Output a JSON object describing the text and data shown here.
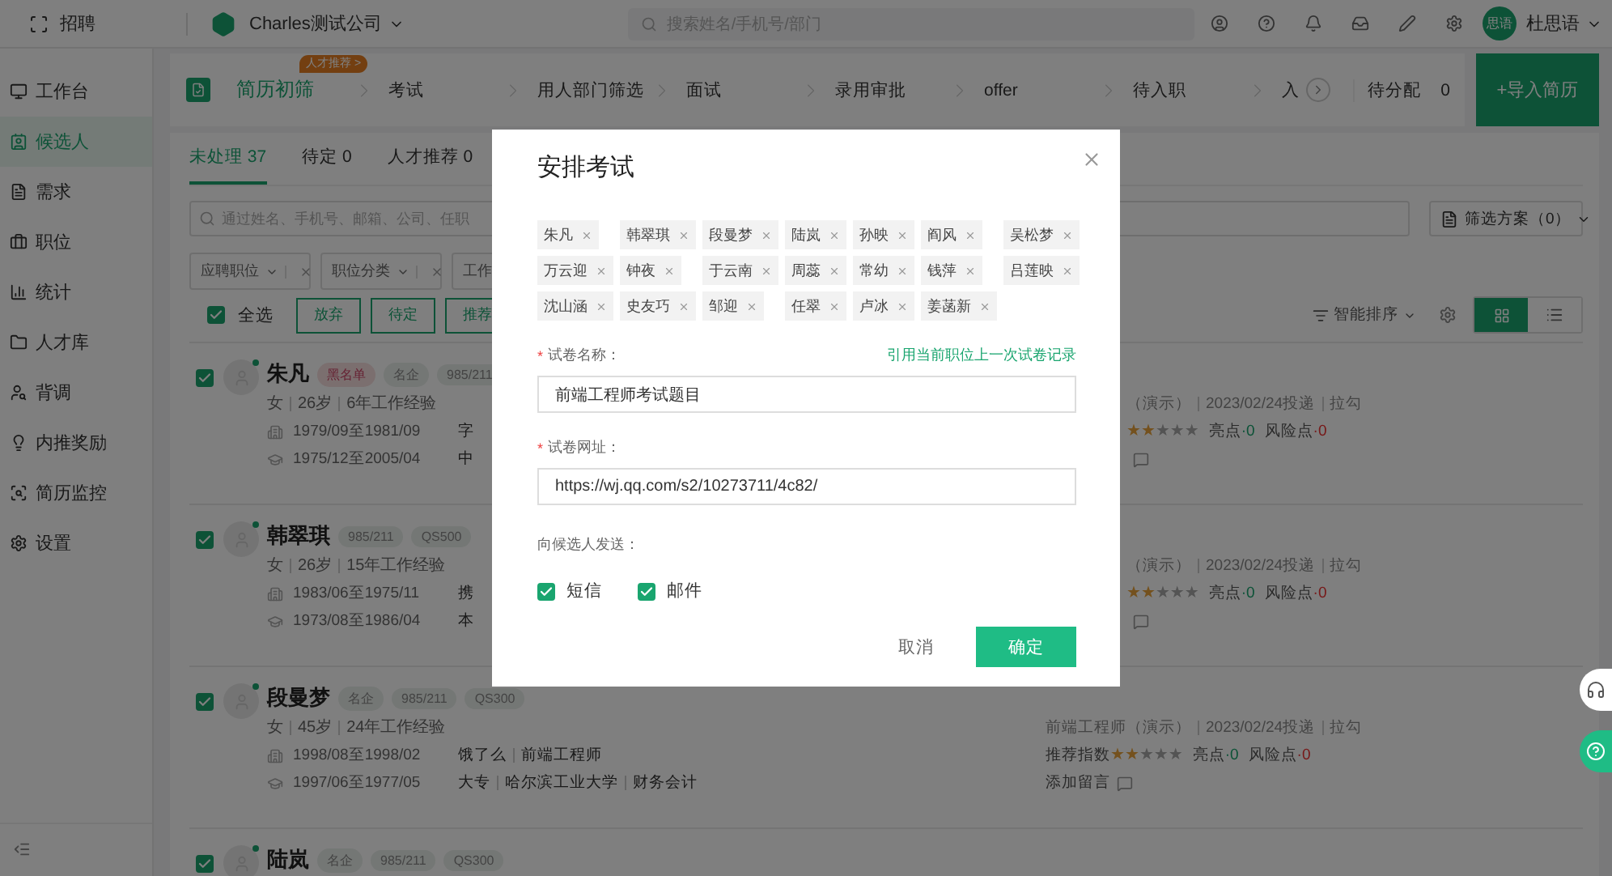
{
  "top_bar": {
    "app_name": "招聘",
    "company": "Charles测试公司",
    "search": {
      "placeholder": "搜索姓名/手机号/部门"
    },
    "user": {
      "avatar": "思语",
      "name": "杜思语"
    }
  },
  "sidebar": {
    "items": [
      {
        "label": "工作台",
        "selected": false
      },
      {
        "label": "候选人",
        "selected": true
      },
      {
        "label": "需求",
        "selected": false
      },
      {
        "label": "职位",
        "selected": false
      },
      {
        "label": "统计",
        "selected": false
      },
      {
        "label": "人才库",
        "selected": false
      },
      {
        "label": "背调",
        "selected": false
      },
      {
        "label": "内推奖励",
        "selected": false
      },
      {
        "label": "简历监控",
        "selected": false
      },
      {
        "label": "设置",
        "selected": false
      }
    ]
  },
  "pipeline": {
    "stages": [
      {
        "label": "简历初筛",
        "selected": true,
        "badge": "人才推荐 >"
      },
      {
        "label": "考试",
        "selected": false
      },
      {
        "label": "用人部门筛选",
        "selected": false
      },
      {
        "label": "面试",
        "selected": false
      },
      {
        "label": "录用审批",
        "selected": false
      },
      {
        "label": "offer",
        "selected": false
      },
      {
        "label": "待入职",
        "selected": false
      },
      {
        "label": "入",
        "selected": false
      }
    ],
    "unassigned": {
      "label": "待分配",
      "count": "0"
    },
    "import_button": "+导入简历"
  },
  "tabs": [
    {
      "label": "未处理",
      "count": "37",
      "selected": true
    },
    {
      "label": "待定",
      "count": "0",
      "selected": false
    },
    {
      "label": "人才推荐",
      "count": "0",
      "selected": false
    }
  ],
  "search": {
    "placeholder": "通过姓名、手机号、邮箱、公司、任职"
  },
  "filter_scheme": "筛选方案（0）",
  "filters": [
    {
      "label": "应聘职位"
    },
    {
      "label": "职位分类"
    },
    {
      "label": "工作"
    }
  ],
  "select_all": {
    "label": "全选",
    "checked": true
  },
  "batch_buttons": [
    "放弃",
    "待定",
    "推荐"
  ],
  "sort": "智能排序",
  "view_modes": [
    {
      "kind": "grid",
      "selected": true
    },
    {
      "kind": "list",
      "selected": false
    }
  ],
  "candidates": [
    {
      "name": "朱凡",
      "checked": true,
      "tags": [
        {
          "label": "黑名单",
          "kind": "blacklist"
        },
        {
          "label": "名企",
          "kind": "plain"
        },
        {
          "label": "985/211",
          "kind": "plain"
        }
      ],
      "profile": [
        "女",
        "26岁",
        "6年工作经验"
      ],
      "work": {
        "period": "1979/09至1981/09",
        "detail": [
          "字"
        ]
      },
      "education": {
        "period": "1975/12至2005/04",
        "detail": [
          "中"
        ]
      },
      "job": "（演示）",
      "applied": "2023/02/24投递",
      "source": "拉勾",
      "stars": 2,
      "highlights": {
        "label": "亮点",
        "count": "·0"
      },
      "risks": {
        "label": "风险点",
        "count": "·0"
      }
    },
    {
      "name": "韩翠琪",
      "checked": true,
      "tags": [
        {
          "label": "985/211",
          "kind": "plain"
        },
        {
          "label": "QS500",
          "kind": "plain"
        }
      ],
      "profile": [
        "女",
        "26岁",
        "15年工作经验"
      ],
      "work": {
        "period": "1983/06至1975/11",
        "detail": [
          "携"
        ]
      },
      "education": {
        "period": "1973/08至1986/04",
        "detail": [
          "本"
        ]
      },
      "job": "（演示）",
      "applied": "2023/02/24投递",
      "source": "拉勾",
      "stars": 2,
      "highlights": {
        "label": "亮点",
        "count": "·0"
      },
      "risks": {
        "label": "风险点",
        "count": "·0"
      }
    },
    {
      "name": "段曼梦",
      "checked": true,
      "tags": [
        {
          "label": "名企",
          "kind": "plain"
        },
        {
          "label": "985/211",
          "kind": "plain"
        },
        {
          "label": "QS300",
          "kind": "plain"
        }
      ],
      "profile": [
        "女",
        "45岁",
        "24年工作经验"
      ],
      "work": {
        "period": "1998/08至1998/02",
        "detail": [
          "饿了么",
          "前端工程师"
        ]
      },
      "education": {
        "period": "1997/06至1977/05",
        "detail": [
          "大专",
          "哈尔滨工业大学",
          "财务会计"
        ]
      },
      "job": "前端工程师（演示）",
      "applied": "2023/02/24投递",
      "source": "拉勾",
      "rating_label": "推荐指数",
      "stars": 2,
      "highlights": {
        "label": "亮点",
        "count": "·0"
      },
      "risks": {
        "label": "风险点",
        "count": "·0"
      },
      "comment_label": "添加留言"
    },
    {
      "name": "陆岚",
      "checked": true,
      "tags": [
        {
          "label": "名企",
          "kind": "plain"
        },
        {
          "label": "985/211",
          "kind": "plain"
        },
        {
          "label": "QS300",
          "kind": "plain"
        }
      ]
    }
  ],
  "modal": {
    "title": "安排考试",
    "selected_candidates": [
      "朱凡",
      "韩翠琪",
      "段曼梦",
      "陆岚",
      "孙映",
      "阎风",
      "吴松梦",
      "万云迎",
      "钟夜",
      "于云南",
      "周蕊",
      "常幼",
      "钱萍",
      "吕莲映",
      "沈山涵",
      "史友巧",
      "邹迎",
      "任翠",
      "卢冰",
      "姜菡新"
    ],
    "fields": [
      {
        "label": "试卷名称：",
        "required_mark": "*",
        "link": "引用当前职位上一次试卷记录",
        "value": "前端工程师考试题目"
      },
      {
        "label": "试卷网址：",
        "required_mark": "*",
        "value": "https://wj.qq.com/s2/10273711/4c82/"
      }
    ],
    "send_label": "向候选人发送：",
    "send_options": [
      {
        "label": "短信",
        "checked": true
      },
      {
        "label": "邮件",
        "checked": true
      }
    ],
    "cancel": "取消",
    "confirm": "确定"
  }
}
